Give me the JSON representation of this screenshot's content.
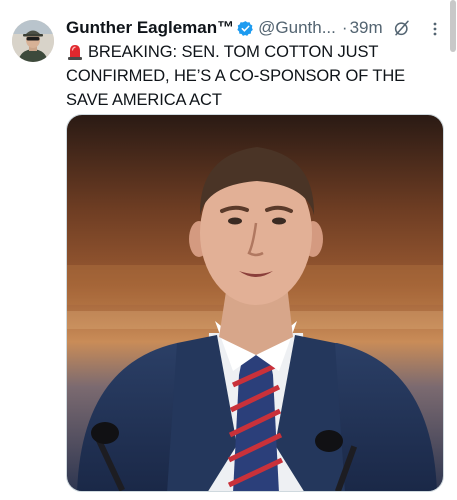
{
  "tweet": {
    "author_name": "Gunther Eagleman™",
    "handle": "@Gunth...",
    "separator": "·",
    "time": "39m",
    "text": "BREAKING: SEN. TOM COTTON JUST CONFIRMED, HE’S A CO-SPONSOR OF THE SAVE AMERICA ACT",
    "emoji_icon": "police-siren-icon"
  },
  "icons": {
    "verified": "verified-badge-icon",
    "grok": "grok-icon",
    "more": "more-options-icon"
  },
  "colors": {
    "verified_blue": "#1d9bf0",
    "text": "#0f1419",
    "secondary_text": "#536471",
    "border": "#cfd9de"
  }
}
